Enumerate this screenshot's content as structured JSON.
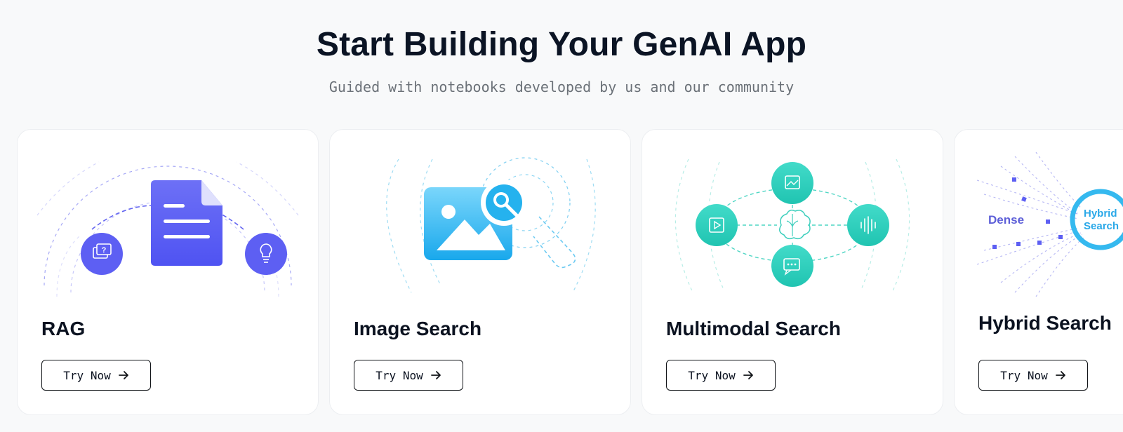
{
  "hero": {
    "title": "Start Building Your GenAI App",
    "subtitle": "Guided with notebooks developed by us and our community"
  },
  "cards": [
    {
      "title": "RAG",
      "button_label": "Try Now",
      "illustration": "document-with-question-and-lightbulb",
      "accent_color": "#5b5ff5"
    },
    {
      "title": "Image Search",
      "button_label": "Try Now",
      "illustration": "image-with-magnifier",
      "accent_color": "#2bb6f0"
    },
    {
      "title": "Multimodal Search",
      "button_label": "Try Now",
      "illustration": "brain-with-media-nodes",
      "accent_color": "#2fd4c0"
    },
    {
      "title": "Hybrid Search",
      "button_label": "Try Now",
      "illustration": "dense-to-hybrid-search",
      "accent_color": "#31b4ee",
      "diagram_labels": {
        "dense": "Dense",
        "hybrid_line1": "Hybrid",
        "hybrid_line2": "Search"
      }
    }
  ],
  "icons": {
    "arrow": "arrow-right-icon"
  }
}
